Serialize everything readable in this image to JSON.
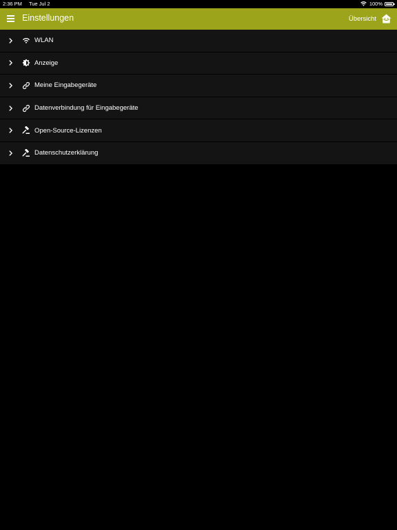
{
  "status_bar": {
    "time": "2:36 PM",
    "date": "Tue Jul 2",
    "battery": "100%",
    "wifi_icon": "wifi-icon",
    "battery_icon": "battery-icon"
  },
  "app_bar": {
    "title": "Einstellungen",
    "overview_label": "Übersicht",
    "menu_icon": "hamburger-menu-icon",
    "home_icon": "home-icon",
    "background_color": "#9ba41a"
  },
  "settings": {
    "items": [
      {
        "label": "WLAN",
        "icon": "wifi-icon"
      },
      {
        "label": "Anzeige",
        "icon": "brightness-icon"
      },
      {
        "label": "Meine Eingabegeräte",
        "icon": "link-icon"
      },
      {
        "label": "Datenverbindung für Eingabegeräte",
        "icon": "link-icon"
      },
      {
        "label": "Open-Source-Lizenzen",
        "icon": "gavel-icon"
      },
      {
        "label": "Datenschutzerklärung",
        "icon": "gavel-icon"
      }
    ]
  }
}
